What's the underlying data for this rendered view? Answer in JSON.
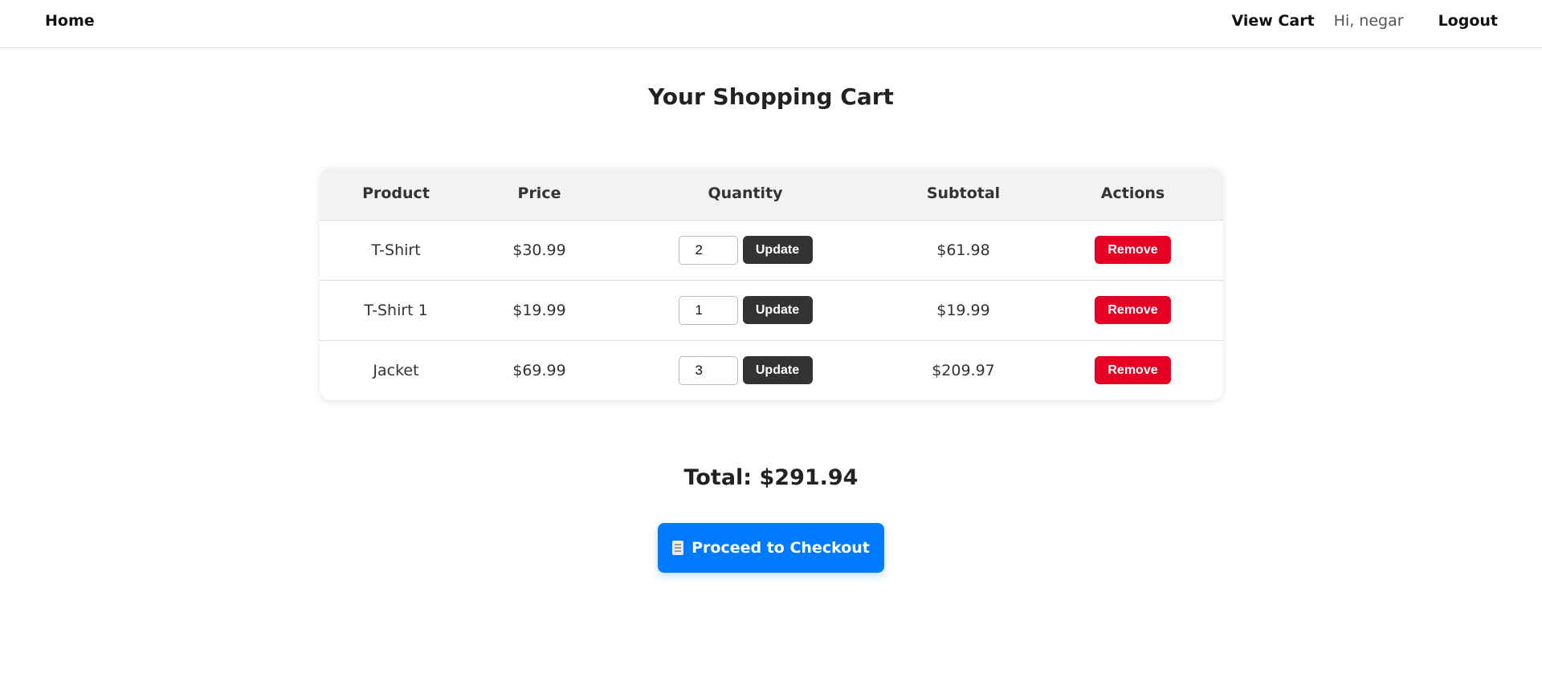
{
  "nav": {
    "home": "Home",
    "view_cart": "View Cart",
    "greeting": "Hi, negar",
    "logout": "Logout"
  },
  "page": {
    "title": "Your Shopping Cart"
  },
  "table": {
    "headers": {
      "product": "Product",
      "price": "Price",
      "quantity": "Quantity",
      "subtotal": "Subtotal",
      "actions": "Actions"
    },
    "rows": [
      {
        "product": "T-Shirt",
        "price": "$30.99",
        "quantity": "2",
        "subtotal": "$61.98",
        "update_label": "Update",
        "remove_label": "Remove"
      },
      {
        "product": "T-Shirt 1",
        "price": "$19.99",
        "quantity": "1",
        "subtotal": "$19.99",
        "update_label": "Update",
        "remove_label": "Remove"
      },
      {
        "product": "Jacket",
        "price": "$69.99",
        "quantity": "3",
        "subtotal": "$209.97",
        "update_label": "Update",
        "remove_label": "Remove"
      }
    ]
  },
  "summary": {
    "total": "Total: $291.94",
    "checkout_label": "Proceed to Checkout",
    "checkout_icon": "receipt-icon"
  },
  "colors": {
    "checkout": "#007bff",
    "remove": "#e60023",
    "update": "#333333"
  }
}
